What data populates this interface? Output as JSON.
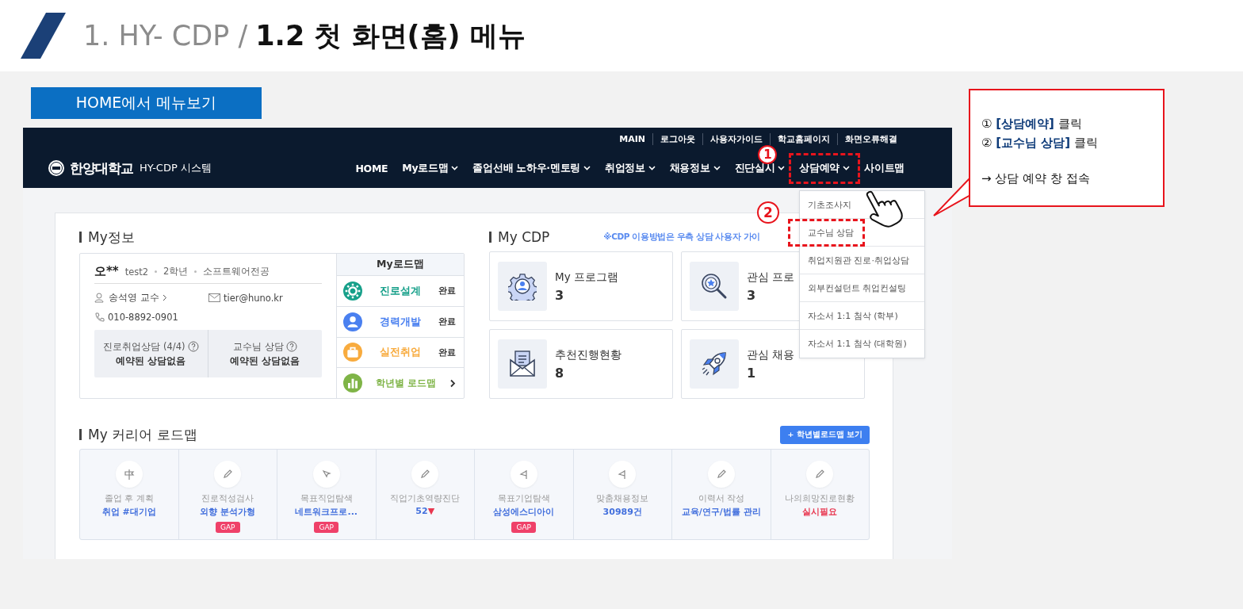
{
  "slide": {
    "section": "1. HY- CDP /",
    "title": "1.2 첫 화면(홈) 메뉴"
  },
  "label": "HOME에서 메뉴보기",
  "site": {
    "top_links": [
      "MAIN",
      "로그아웃",
      "사용자가이드",
      "학교홈페이지",
      "화면오류해결"
    ],
    "logo_text": "한양대학교",
    "system_name": "HY-CDP 시스템",
    "nav": [
      {
        "label": "HOME",
        "has_caret": false,
        "highlighted": false
      },
      {
        "label": "My로드맵",
        "has_caret": true,
        "highlighted": false
      },
      {
        "label": "졸업선배 노하우·멘토링",
        "has_caret": true,
        "highlighted": false
      },
      {
        "label": "취업정보",
        "has_caret": true,
        "highlighted": false
      },
      {
        "label": "채용정보",
        "has_caret": true,
        "highlighted": false
      },
      {
        "label": "진단실시",
        "has_caret": true,
        "highlighted": false
      },
      {
        "label": "상담예약",
        "has_caret": true,
        "highlighted": true,
        "step": "1"
      },
      {
        "label": "사이트맵",
        "has_caret": false,
        "highlighted": false
      }
    ],
    "dropdown": [
      {
        "label": "기초조사지",
        "highlighted": false
      },
      {
        "label": "교수님 상담",
        "highlighted": true,
        "step": "2"
      },
      {
        "label": "취업지원관 진로·취업상담",
        "highlighted": false
      },
      {
        "label": "외부컨설턴트 취업컨설팅",
        "highlighted": false
      },
      {
        "label": "자소서 1:1 첨삭 (학부)",
        "highlighted": false
      },
      {
        "label": "자소서 1:1 첨삭 (대학원)",
        "highlighted": false
      }
    ]
  },
  "my_info": {
    "heading": "My정보",
    "name": "오**",
    "id": "test2",
    "grade": "2학년",
    "major": "소프트웨어전공",
    "professor": "송석영 교수",
    "email": "tier@huno.kr",
    "phone": "010-8892-0901",
    "counsel": [
      {
        "title": "진로취업상담 (4/4)",
        "status": "예약된 상담없음"
      },
      {
        "title": "교수님 상담",
        "status": "예약된 상담없음"
      }
    ]
  },
  "roadmap": {
    "heading": "My로드맵",
    "items": [
      {
        "kind": "step",
        "label": "진로설계",
        "status": "완료",
        "color": "#17a08a"
      },
      {
        "kind": "step",
        "label": "경력개발",
        "status": "완료",
        "color": "#4a80f0"
      },
      {
        "kind": "step",
        "label": "실전취업",
        "status": "완료",
        "color": "#f8ab3e"
      },
      {
        "kind": "link",
        "label": "학년별 로드맵",
        "color": "#7fb447"
      }
    ]
  },
  "my_cdp": {
    "heading": "My CDP",
    "notice": "※CDP 이용방법은 우측 상담 사용자 가이",
    "cards": [
      {
        "label": "My 프로그램",
        "value": "3"
      },
      {
        "label": "관심 프로",
        "value": "3"
      },
      {
        "label": "추천진행현황",
        "value": "8"
      },
      {
        "label": "관심 채용",
        "value": "1"
      }
    ]
  },
  "career": {
    "heading": "My 커리어 로드맵",
    "button": "+ 학년별로드맵 보기",
    "steps": [
      {
        "title": "졸업 후 계획",
        "value": "취업 #대기업",
        "alert": false
      },
      {
        "title": "진로적성검사",
        "value": "외향 분석가형",
        "badge": "GAP",
        "alert": false
      },
      {
        "title": "목표직업탐색",
        "value": "네트워크프로...",
        "badge": "GAP",
        "alert": false
      },
      {
        "title": "직업기초역량진단",
        "value": "52",
        "marker": "▼",
        "alert": false
      },
      {
        "title": "목표기업탐색",
        "value": "삼성에스디아이",
        "badge": "GAP",
        "alert": false
      },
      {
        "title": "맞춤채용정보",
        "value": "30989건",
        "alert": false
      },
      {
        "title": "이력서 작성",
        "value": "교육/연구/법률 관리",
        "alert": false
      },
      {
        "title": "나의희망진로현황",
        "value": "실시필요",
        "alert": true
      }
    ]
  },
  "callout": {
    "lines": [
      {
        "num": "①",
        "bold": "[상담예약]",
        "text": "클릭"
      },
      {
        "num": "②",
        "bold": "[교수님 상담]",
        "text": "클릭"
      }
    ],
    "result": "→ 상담 예약 창 접속"
  }
}
